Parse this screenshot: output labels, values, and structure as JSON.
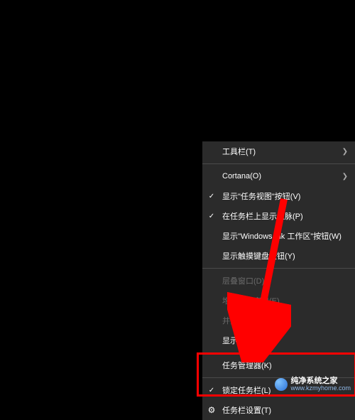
{
  "menu": {
    "toolbars": "工具栏(T)",
    "cortana": "Cortana(O)",
    "taskview": "显示\"任务视图\"按钮(V)",
    "people": "在任务栏上显示人脉(P)",
    "ink": "显示\"Windows Ink 工作区\"按钮(W)",
    "touchkb": "显示触摸键盘按钮(Y)",
    "cascade": "层叠窗口(D)",
    "stacked": "堆叠显示窗口(E)",
    "sidebyside": "并排显示窗口(I)",
    "desktop": "显示桌面(S)",
    "taskmgr": "任务管理器(K)",
    "lock": "锁定任务栏(L)",
    "settings": "任务栏设置(T)"
  },
  "watermark": {
    "title": "纯净系统之家",
    "url": "www.kzmyhome.com"
  },
  "annotation": {
    "highlight_color": "#ff0000",
    "arrow_color": "#ff0000"
  }
}
